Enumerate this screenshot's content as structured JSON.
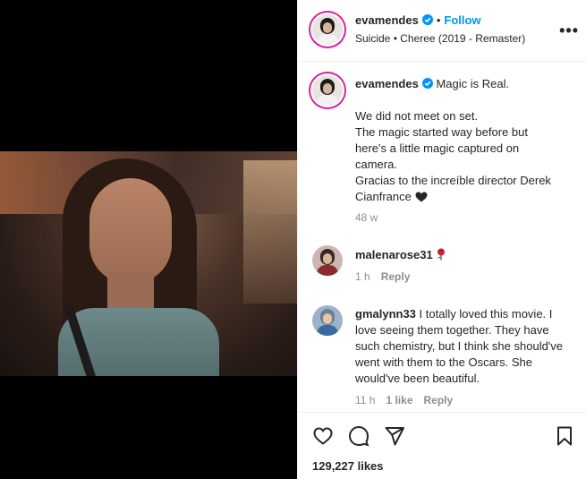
{
  "post": {
    "username": "evamendes",
    "follow_label": "Follow",
    "separator": "•",
    "audio": "Suicide • Cheree (2019 - Remaster)",
    "more_label": "•••"
  },
  "caption": {
    "username": "evamendes",
    "lines": [
      "Magic is Real.",
      "",
      "We did not meet on set.",
      "The magic started way before but",
      "here's a little magic captured on",
      "camera.",
      "Gracias to the increíble director Derek",
      "Cianfrance"
    ],
    "time": "48 w"
  },
  "comments": [
    {
      "username": "malenarose31",
      "text": "",
      "time": "1 h",
      "likes": "",
      "reply_label": "Reply"
    },
    {
      "username": "gmalynn33",
      "text": "I totally loved this movie. I love seeing them together. They have such chemistry, but I think she should've went with them to the Oscars. She would've been beautiful.",
      "time": "11 h",
      "likes": "1 like",
      "reply_label": "Reply"
    }
  ],
  "footer": {
    "likes": "129,227 likes"
  },
  "colors": {
    "accent": "#0095f6",
    "text": "#262626",
    "muted": "#8e8e8e",
    "border": "#efefef"
  }
}
